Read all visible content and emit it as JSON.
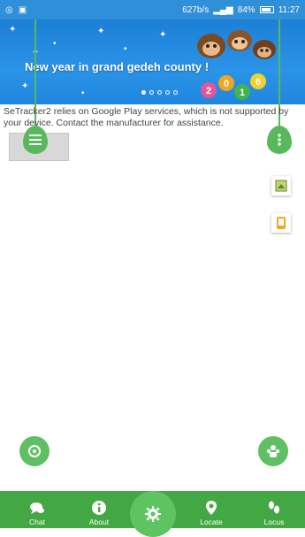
{
  "status_bar": {
    "speed": "627b/s",
    "battery_percent": "84%",
    "time": "11:27"
  },
  "banner": {
    "title": "New year in grand gedeh county !",
    "year": "2016",
    "dot_count": 5,
    "active_dot": 0
  },
  "notice": {
    "text": "SeTracker2 relies on Google Play services, which is not supported by your device. Contact the manufacturer for assistance."
  },
  "bottom_nav": {
    "items": [
      {
        "label": "Chat",
        "icon": "chat-icon"
      },
      {
        "label": "About",
        "icon": "info-icon"
      },
      {
        "label": "",
        "icon": "gear-icon"
      },
      {
        "label": "Locate",
        "icon": "location-pin-icon"
      },
      {
        "label": "Locus",
        "icon": "footprints-icon"
      }
    ]
  },
  "colors": {
    "status_bar": "#2f8fd8",
    "banner": "#1d7fd6",
    "accent_green": "#43a843",
    "fab_green": "#5fbf63"
  }
}
